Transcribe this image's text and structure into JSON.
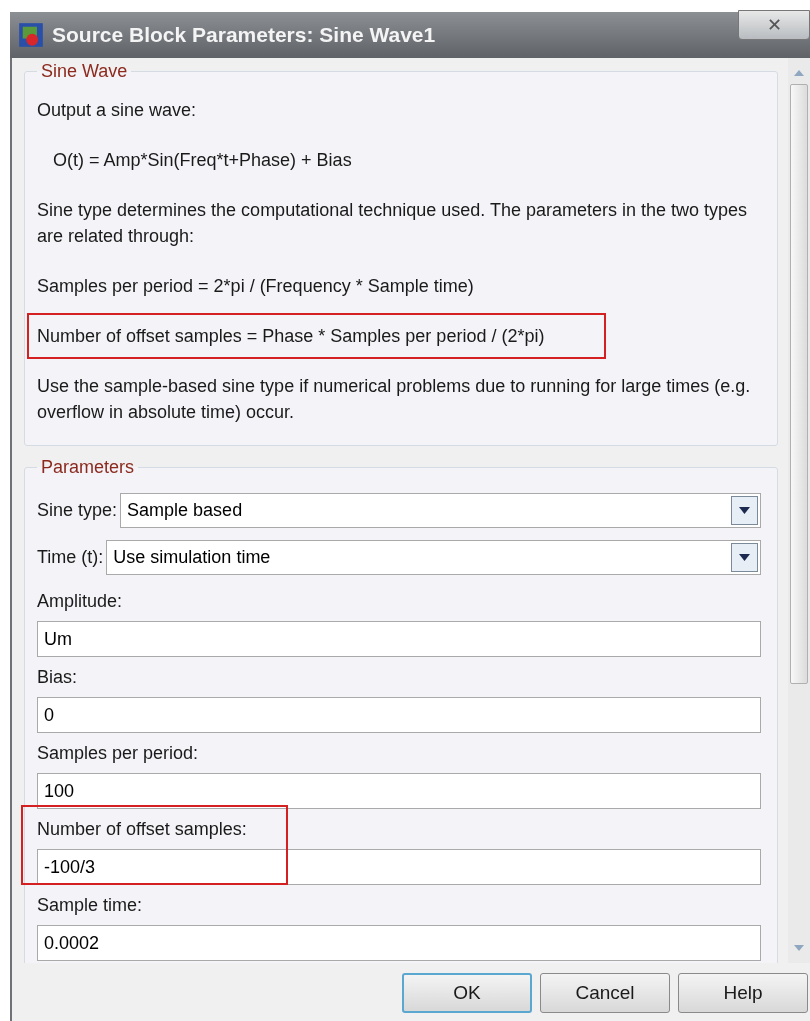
{
  "window": {
    "title": "Source Block Parameters: Sine Wave1",
    "close": "✕"
  },
  "description": {
    "title": "Sine Wave",
    "paragraphs": [
      {
        "text": "Output a sine wave:",
        "indent": false,
        "highlighted": false
      },
      {
        "text": "O(t) = Amp*Sin(Freq*t+Phase) + Bias",
        "indent": true,
        "highlighted": false
      },
      {
        "text": "Sine type determines the computational technique used. The parameters in the two types are related through:",
        "indent": false,
        "highlighted": false
      },
      {
        "text": "Samples per period = 2*pi / (Frequency * Sample time)",
        "indent": false,
        "highlighted": false
      },
      {
        "text": "Number of offset samples = Phase * Samples per period / (2*pi)",
        "indent": false,
        "highlighted": true
      },
      {
        "text": "Use the sample-based sine type if numerical problems due to running for large times (e.g. overflow in absolute time) occur.",
        "indent": false,
        "highlighted": false
      }
    ]
  },
  "parameters": {
    "title": "Parameters",
    "fields": [
      {
        "kind": "dropdown",
        "label": "Sine type:",
        "value": "Sample based",
        "highlighted": false
      },
      {
        "kind": "dropdown",
        "label": "Time (t):",
        "value": "Use simulation time",
        "highlighted": false
      },
      {
        "kind": "text",
        "label": "Amplitude:",
        "value": "Um",
        "highlighted": false
      },
      {
        "kind": "text",
        "label": "Bias:",
        "value": "0",
        "highlighted": false
      },
      {
        "kind": "text",
        "label": "Samples per period:",
        "value": "100",
        "highlighted": false
      },
      {
        "kind": "text",
        "label": "Number of offset samples:",
        "value": "-100/3",
        "highlighted": true
      },
      {
        "kind": "text",
        "label": "Sample time:",
        "value": "0.0002",
        "highlighted": false
      }
    ]
  },
  "buttons": [
    {
      "label": "OK",
      "default": true
    },
    {
      "label": "Cancel",
      "default": false
    },
    {
      "label": "Help",
      "default": false
    }
  ]
}
